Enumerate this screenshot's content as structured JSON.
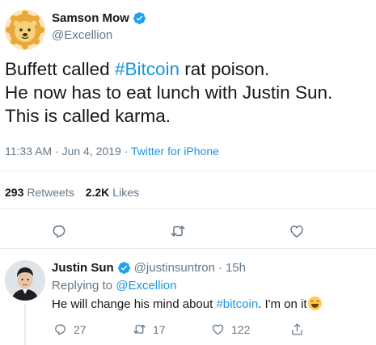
{
  "tweet": {
    "author": {
      "name": "Samson Mow",
      "handle": "@Excellion",
      "verified": true
    },
    "text_lines": [
      {
        "before": "Buffett called ",
        "hashtag": "#Bitcoin",
        "after": " rat poison."
      },
      {
        "before": "He now has to eat lunch with Justin Sun.",
        "hashtag": "",
        "after": ""
      },
      {
        "before": "This is called karma.",
        "hashtag": "",
        "after": ""
      }
    ],
    "time": "11:33 AM",
    "date": "Jun 4, 2019",
    "separator": "·",
    "source": "Twitter for iPhone",
    "retweets_count": "293",
    "retweets_label": "Retweets",
    "likes_count": "2.2K",
    "likes_label": "Likes",
    "actions": [
      "reply-icon",
      "retweet-icon",
      "like-icon"
    ]
  },
  "reply": {
    "author": {
      "name": "Justin Sun",
      "handle": "@justinsuntron",
      "verified": true
    },
    "separator": "·",
    "time": "15h",
    "replying_to_label": "Replying to",
    "replying_to_handle": "@Excellion",
    "text_before": "He will change his mind about ",
    "text_hashtag": "#bitcoin",
    "text_after": ". I'm on it",
    "emoji": "grinning-squinting-face",
    "reply_count": "27",
    "retweet_count": "17",
    "like_count": "122"
  },
  "colors": {
    "accent": "#1b95e0",
    "muted": "#657786",
    "text": "#14171a",
    "verified": "#1da1f2",
    "divider": "#e6ecf0"
  }
}
